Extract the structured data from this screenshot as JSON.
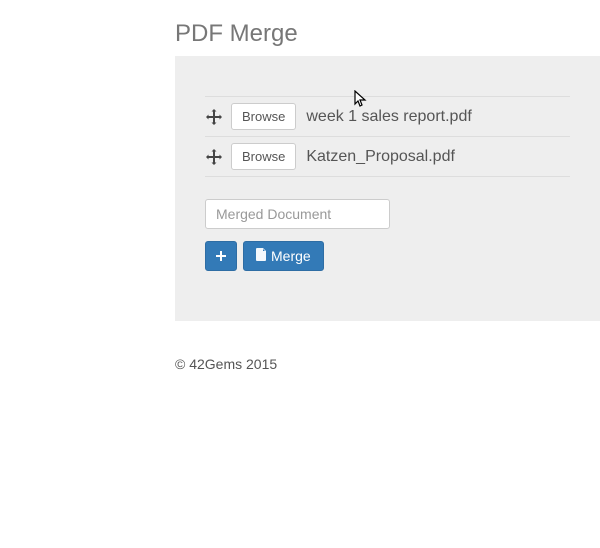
{
  "title": "PDF Merge",
  "files": [
    {
      "browse_label": "Browse",
      "name": "week 1 sales report.pdf"
    },
    {
      "browse_label": "Browse",
      "name": "Katzen_Proposal.pdf"
    }
  ],
  "output_placeholder": "Merged Document",
  "output_value": "",
  "add_button_label": "+",
  "merge_button_label": "Merge",
  "footer": "© 42Gems 2015"
}
